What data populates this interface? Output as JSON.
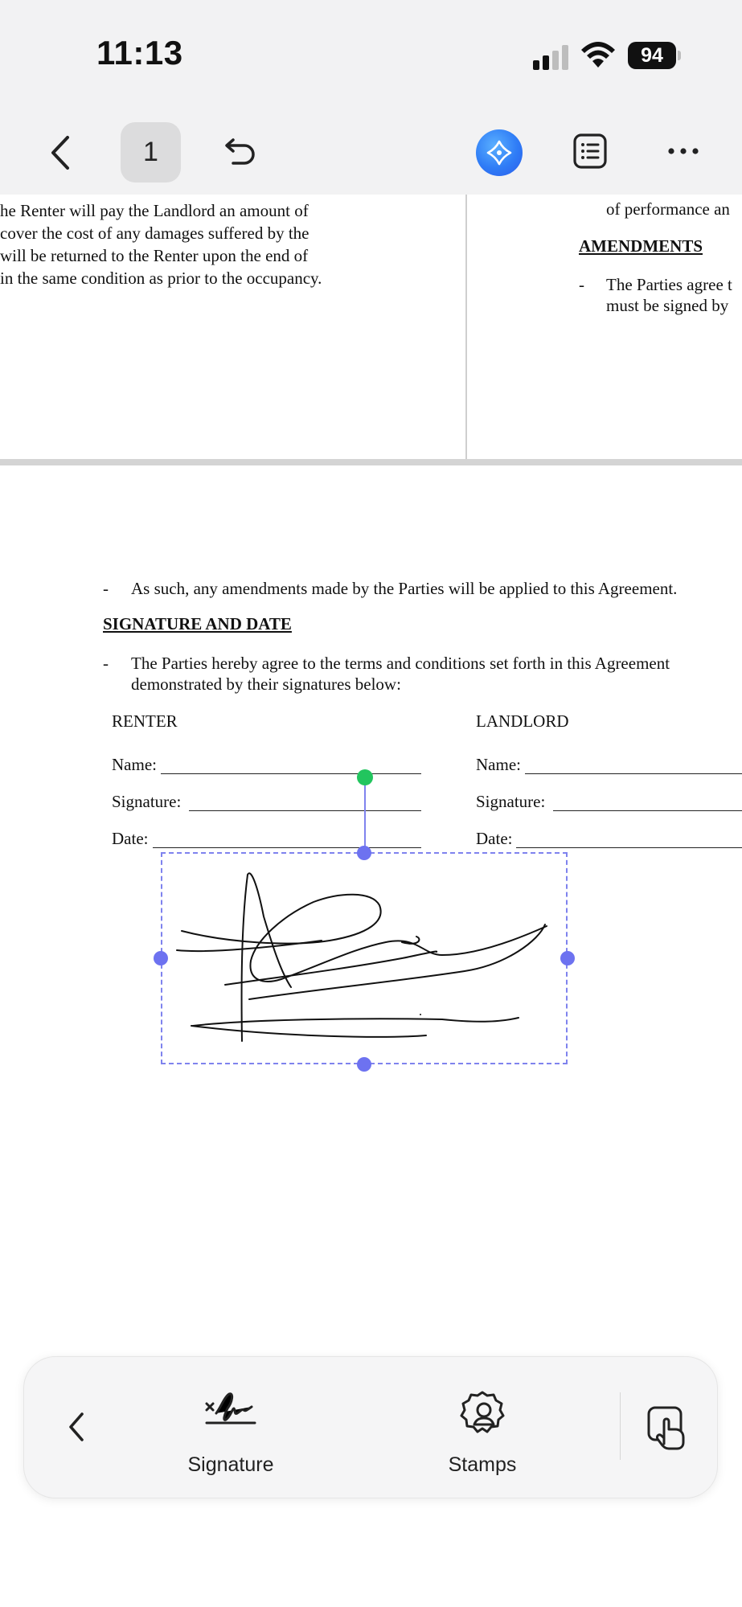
{
  "status_bar": {
    "time": "11:13",
    "battery": "94"
  },
  "nav": {
    "page_number": "1"
  },
  "document": {
    "page1_left_lines": [
      "he Renter will pay the Landlord an amount of",
      "cover the cost of any damages suffered by the",
      "will be returned to the Renter upon the end of",
      "in the same condition as prior to the occupancy."
    ],
    "page1_right_top_line": "of performance an",
    "page1_right_heading": "AMENDMENTS",
    "page1_right_bullet_line1": "The Parties agree t",
    "page1_right_bullet_line2": "must be signed by",
    "bullet_mark": "-",
    "page2_amendment_line": "As such, any amendments made by the Parties will be applied to this Agreement.",
    "signature_heading": "SIGNATURE AND DATE",
    "terms_line1": "The Parties hereby agree to the terms and conditions set forth in this Agreement",
    "terms_line2": "demonstrated by their signatures below:",
    "renter_label": "RENTER",
    "landlord_label": "LANDLORD",
    "name_label": "Name:",
    "signature_label": "Signature:",
    "date_label": "Date:"
  },
  "toolbar": {
    "signature_label": "Signature",
    "stamps_label": "Stamps"
  },
  "colors": {
    "accent": "#6d72f0",
    "rotate_handle": "#22c55e",
    "ai_button": "#2f7cf6"
  }
}
